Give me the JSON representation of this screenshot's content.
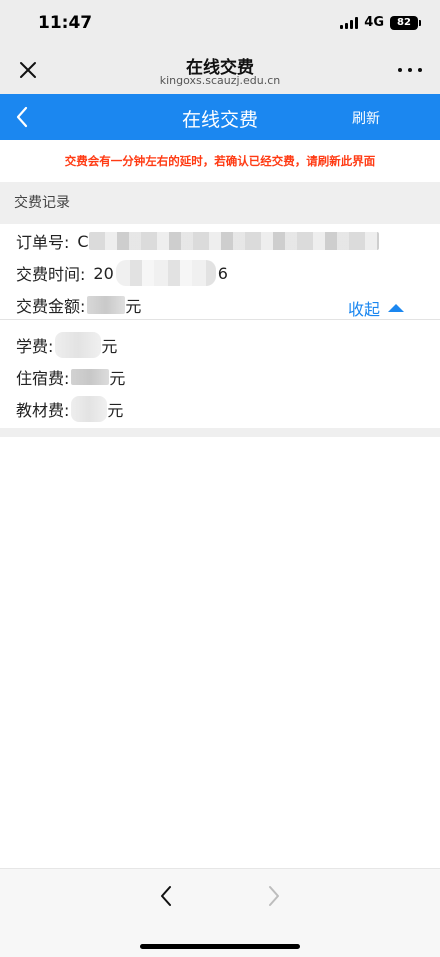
{
  "status": {
    "time": "11:47",
    "network": "4G",
    "battery": "82"
  },
  "wechat": {
    "title": "在线交费",
    "domain": "kingoxs.scauzj.edu.cn"
  },
  "header": {
    "title": "在线交费",
    "refresh_label": "刷新"
  },
  "notice": "交费会有一分钟左右的延时，若确认已经交费，请刷新此界面",
  "section": {
    "title": "交费记录"
  },
  "record": {
    "order_label": "订单号:",
    "order_prefix": "C",
    "time_label": "交费时间:",
    "time_prefix": "20",
    "time_suffix": "6",
    "amount_label": "交费金额:",
    "amount_unit": "元",
    "collapse_label": "收起"
  },
  "fees": [
    {
      "label": "学费:",
      "unit": "元"
    },
    {
      "label": "住宿费:",
      "unit": "元"
    },
    {
      "label": "教材费:",
      "unit": "元"
    }
  ],
  "colors": {
    "accent": "#1b87f0",
    "notice": "#ff3b14"
  }
}
